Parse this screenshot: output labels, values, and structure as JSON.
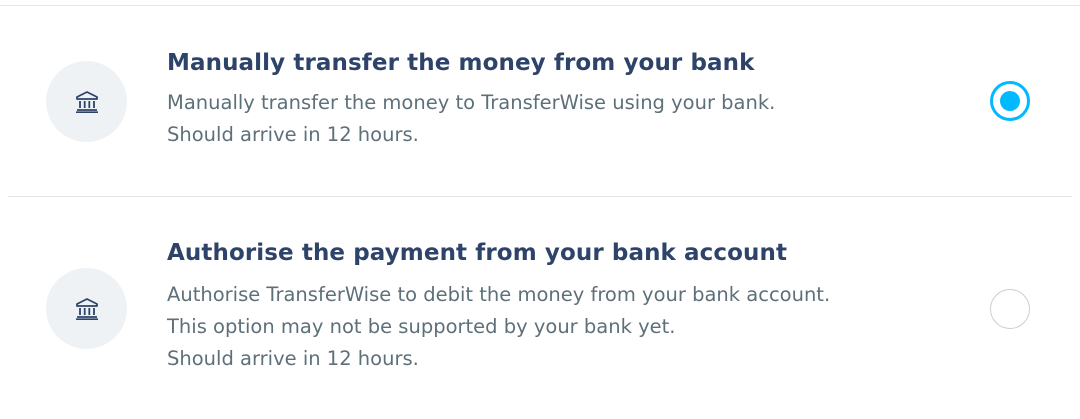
{
  "options": [
    {
      "icon": "bank-icon",
      "title": "Manually transfer the money from your bank",
      "description_lines": [
        "Manually transfer the money to TransferWise using your bank.",
        "Should arrive in 12 hours."
      ],
      "selected": true
    },
    {
      "icon": "bank-icon",
      "title": "Authorise the payment from your bank account",
      "description_lines": [
        "Authorise TransferWise to debit the money from your bank account.",
        "This option may not be supported by your bank yet.",
        "Should arrive in 12 hours."
      ],
      "selected": false
    }
  ],
  "colors": {
    "title": "#2e4369",
    "description": "#5d7079",
    "accent": "#00b9ff",
    "icon_background": "#eef2f5",
    "divider": "#e3e6e8"
  }
}
